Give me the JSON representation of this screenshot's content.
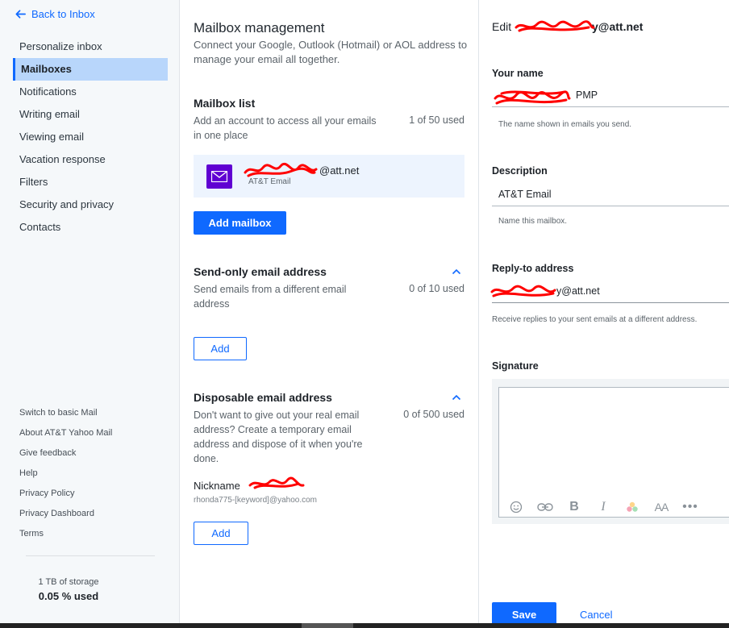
{
  "sidebar": {
    "back_label": "Back to Inbox",
    "items": [
      {
        "label": "Personalize inbox"
      },
      {
        "label": "Mailboxes"
      },
      {
        "label": "Notifications"
      },
      {
        "label": "Writing email"
      },
      {
        "label": "Viewing email"
      },
      {
        "label": "Vacation response"
      },
      {
        "label": "Filters"
      },
      {
        "label": "Security and privacy"
      },
      {
        "label": "Contacts"
      }
    ],
    "footer_links": [
      {
        "label": "Switch to basic Mail"
      },
      {
        "label": "About AT&T Yahoo Mail"
      },
      {
        "label": "Give feedback"
      },
      {
        "label": "Help"
      },
      {
        "label": "Privacy Policy"
      },
      {
        "label": "Privacy Dashboard"
      },
      {
        "label": "Terms"
      }
    ],
    "storage": {
      "capacity": "1 TB of storage",
      "used": "0.05 % used"
    }
  },
  "mailbox_management": {
    "title": "Mailbox management",
    "description": "Connect your Google, Outlook (Hotmail) or AOL address to manage your email all together.",
    "mailbox_list": {
      "title": "Mailbox list",
      "description": "Add an account to access all your emails in one place",
      "count": "1 of 50 used",
      "mailbox": {
        "address_suffix": "@att.net",
        "type": "AT&T Email"
      },
      "add_label": "Add mailbox"
    },
    "send_only": {
      "title": "Send-only email address",
      "description": "Send emails from a different email address",
      "count": "0 of 10 used",
      "add_label": "Add"
    },
    "disposable": {
      "title": "Disposable email address",
      "description": "Don't want to give out your real email address? Create a temporary email address and dispose of it when you're done.",
      "count": "0 of 500 used",
      "nickname_label": "Nickname",
      "nickname_hint": "rhonda775-[keyword]@yahoo.com",
      "add_label": "Add"
    }
  },
  "edit_panel": {
    "heading_prefix": "Edit",
    "heading_address_suffix": "y@att.net",
    "your_name": {
      "label": "Your name",
      "value_suffix": "PMP",
      "hint": "The name shown in emails you send."
    },
    "description": {
      "label": "Description",
      "value": "AT&T Email",
      "hint": "Name this mailbox."
    },
    "reply_to": {
      "label": "Reply-to address",
      "value_suffix": "y@att.net",
      "hint": "Receive replies to your sent emails at a different address."
    },
    "signature": {
      "label": "Signature",
      "value": ""
    },
    "save_label": "Save",
    "cancel_label": "Cancel"
  },
  "colors": {
    "accent": "#0f69ff",
    "active_nav": "#b8d6fb",
    "mail_icon": "#6001d2",
    "redaction": "#ff0000"
  }
}
